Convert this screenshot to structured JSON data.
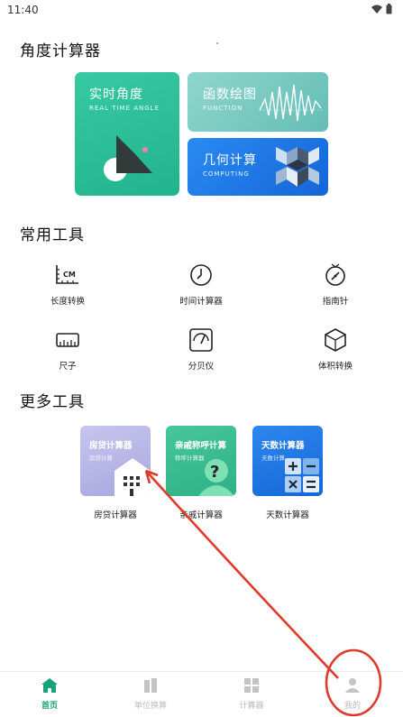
{
  "status": {
    "time": "11:40"
  },
  "sections": {
    "angle": "角度计算器",
    "common": "常用工具",
    "more": "更多工具"
  },
  "hero": {
    "realtime": {
      "title": "实时角度",
      "subtitle": "REAL TIME ANGLE"
    },
    "function": {
      "title": "函数绘图",
      "subtitle": "FUNCTION"
    },
    "geometry": {
      "title": "几何计算",
      "subtitle": "COMPUTING"
    }
  },
  "tools": [
    {
      "label": "长度转换",
      "icon": "ruler-cm-icon"
    },
    {
      "label": "时间计算器",
      "icon": "clock-icon"
    },
    {
      "label": "指南针",
      "icon": "compass-icon"
    },
    {
      "label": "尺子",
      "icon": "ruler-icon"
    },
    {
      "label": "分贝仪",
      "icon": "decibel-meter-icon"
    },
    {
      "label": "体积转换",
      "icon": "cube-icon"
    }
  ],
  "more_tools": [
    {
      "card_title": "房贷计算器",
      "card_sub": "房贷计算",
      "label": "房贷计算器",
      "color": "#b9b9e6"
    },
    {
      "card_title": "亲戚称呼计算",
      "card_sub": "称呼计算器",
      "label": "亲戚计算器",
      "color": "#3dbf8f"
    },
    {
      "card_title": "天数计算器",
      "card_sub": "天数计算",
      "label": "天数计算器",
      "color": "#2477e6"
    }
  ],
  "nav": {
    "home": "首页",
    "unit": "单位换算",
    "calc": "计算器",
    "mine": "我的"
  },
  "colors": {
    "teal": "#2fc29a",
    "nav_active": "#1aa37a",
    "nav_inactive": "#bbbbbb",
    "annotation": "#e03a2a"
  }
}
